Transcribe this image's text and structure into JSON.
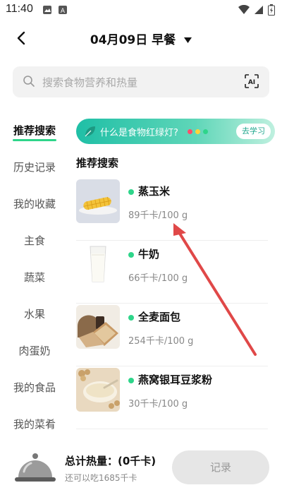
{
  "status_bar": {
    "time": "11:40"
  },
  "header": {
    "date_title": "04月09日 早餐"
  },
  "search": {
    "placeholder": "搜索食物营养和热量",
    "ai_label": "AI"
  },
  "sidebar": {
    "items": [
      {
        "label": "推荐搜索",
        "active": true
      },
      {
        "label": "历史记录"
      },
      {
        "label": "我的收藏"
      },
      {
        "label": "主食"
      },
      {
        "label": "蔬菜"
      },
      {
        "label": "水果"
      },
      {
        "label": "肉蛋奶"
      },
      {
        "label": "我的食品"
      },
      {
        "label": "我的菜肴"
      }
    ]
  },
  "banner": {
    "text": "什么是食物红绿灯?",
    "button": "去学习",
    "dot_colors": [
      "#ff4d6a",
      "#ffd43b",
      "#2ed58a"
    ]
  },
  "section": {
    "title": "推荐搜索"
  },
  "foods": [
    {
      "name": "蒸玉米",
      "calories": "89千卡/100 g",
      "icon": "corn-image"
    },
    {
      "name": "牛奶",
      "calories": "66千卡/100 g",
      "icon": "milk-image"
    },
    {
      "name": "全麦面包",
      "calories": "254千卡/100 g",
      "icon": "bread-image"
    },
    {
      "name": "燕窝银耳豆浆粉",
      "calories": "30千卡/100 g",
      "icon": "soy-milk-image"
    }
  ],
  "bottom": {
    "total": "总计热量：(0千卡)",
    "remaining": "还可以吃1685千卡",
    "record_button": "记录"
  },
  "colors": {
    "accent": "#2ed58a",
    "annotation_arrow": "#e04848"
  }
}
